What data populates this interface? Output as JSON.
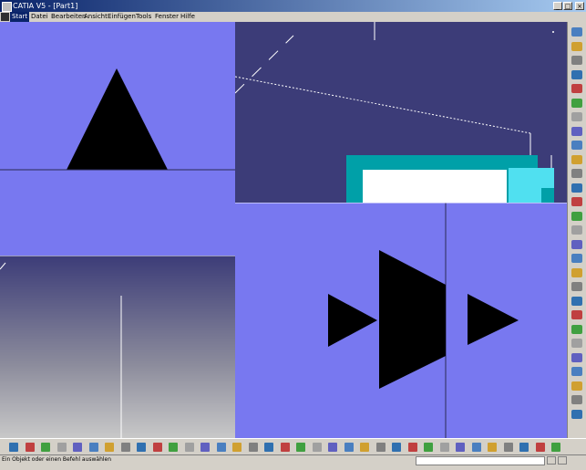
{
  "window": {
    "title": "CATIA V5 - [Part1]",
    "minimize_glyph": "_",
    "maximize_glyph": "□",
    "close_glyph": "×"
  },
  "menu": {
    "items": [
      {
        "label": "Start",
        "active": true
      },
      {
        "label": "Datei"
      },
      {
        "label": "Bearbeiten"
      },
      {
        "label": "Ansicht"
      },
      {
        "label": "Einfügen"
      },
      {
        "label": "Tools"
      },
      {
        "label": "Fenster"
      },
      {
        "label": "Hilfe"
      }
    ]
  },
  "viewports": {
    "background_color": "#7878f0",
    "dark_background_color": "#3c3c78",
    "solid_color": "#000000",
    "block_colors": [
      "#00a0a8",
      "#50e0f0",
      "#ffffff"
    ]
  },
  "right_toolbar": {
    "icons": [
      "compass-icon",
      "sketcher-icon",
      "axis-icon",
      "pad-icon",
      "pocket-icon",
      "shaft-icon",
      "groove-icon",
      "hole-icon",
      "rib-icon",
      "slot-icon",
      "stiffener-icon",
      "loft-icon",
      "fillet-icon",
      "chamfer-icon",
      "draft-icon",
      "shell-icon",
      "thickness-icon",
      "thread-icon",
      "translate-icon",
      "rotate-icon",
      "symmetry-icon",
      "mirror-icon",
      "pattern-icon",
      "scaling-icon",
      "boolean-icon",
      "measure-icon",
      "constraint-icon",
      "plane-icon"
    ]
  },
  "bottom_toolbar": {
    "icons": [
      "new-icon",
      "open-icon",
      "save-icon",
      "print-icon",
      "cut-icon",
      "copy-icon",
      "paste-icon",
      "undo-icon",
      "redo-icon",
      "whats-this-icon",
      "fx-icon",
      "hint-icon",
      "snap-icon",
      "grid-icon",
      "select-icon",
      "fit-all-icon",
      "pan-icon",
      "rotate-view-icon",
      "zoom-in-icon",
      "zoom-out-icon",
      "normal-view-icon",
      "views-icon",
      "render-style-icon",
      "hide-show-icon",
      "swap-visible-icon",
      "layer-icon",
      "properties-icon",
      "measure-between-icon",
      "measure-item-icon",
      "apply-material-icon",
      "analysis-icon",
      "catalog-icon",
      "update-icon",
      "sketch-analysis-icon",
      "constraints-icon"
    ]
  },
  "status": {
    "text": "Ein Objekt oder einen Befehl auswählen"
  }
}
